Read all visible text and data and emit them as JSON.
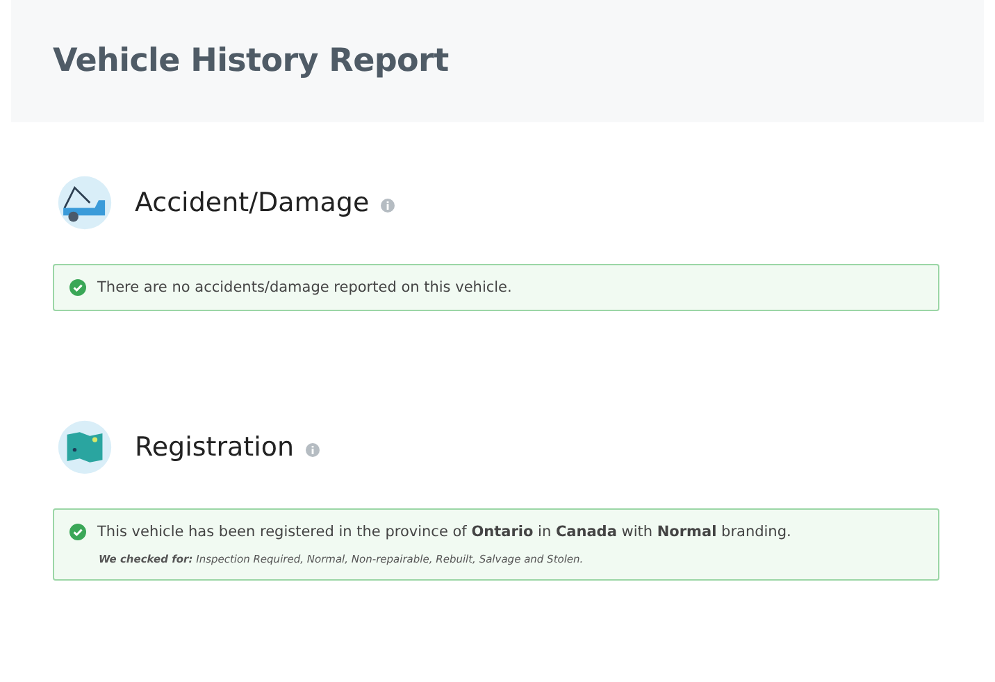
{
  "header": {
    "title": "Vehicle History Report"
  },
  "sections": [
    {
      "kind": "tow",
      "title": "Accident/Damage",
      "alert": {
        "text": "There are no accidents/damage reported on this vehicle."
      }
    },
    {
      "kind": "map",
      "title": "Registration",
      "alert": {
        "text": "This vehicle has been registered in the province of **Ontario** in **Canada** with **Normal** branding.",
        "note": "**We checked for:** Inspection Required, Normal, Non-repairable, Rebuilt, Salvage and Stolen."
      }
    }
  ]
}
